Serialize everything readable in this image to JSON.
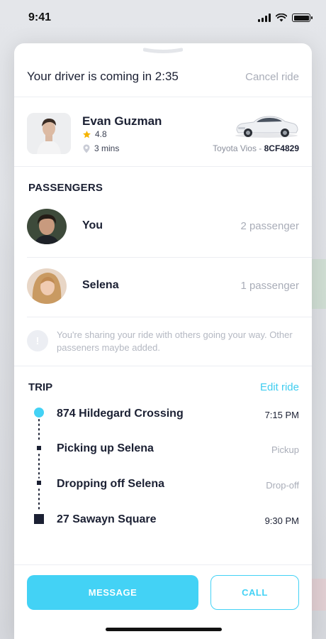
{
  "status_bar": {
    "time": "9:41"
  },
  "header": {
    "eta_text": "Your driver is coming in 2:35",
    "cancel_label": "Cancel ride"
  },
  "driver": {
    "name": "Evan Guzman",
    "rating": "4.8",
    "distance": "3 mins",
    "car_model": "Toyota Vios - ",
    "plate": "8CF4829"
  },
  "passengers": {
    "title": "PASSENGERS",
    "items": [
      {
        "name": "You",
        "count": "2 passenger"
      },
      {
        "name": "Selena",
        "count": "1 passenger"
      }
    ],
    "notice": "You're sharing your ride with others going your way. Other passeners maybe added."
  },
  "trip": {
    "title": "TRIP",
    "edit_label": "Edit ride",
    "stops": [
      {
        "name": "874 Hildegard Crossing",
        "meta": "7:15 PM"
      },
      {
        "name": "Picking up Selena",
        "meta": "Pickup"
      },
      {
        "name": "Dropping off Selena",
        "meta": "Drop-off"
      },
      {
        "name": "27 Sawayn Square",
        "meta": "9:30 PM"
      }
    ]
  },
  "actions": {
    "message_label": "MESSAGE",
    "call_label": "CALL"
  },
  "colors": {
    "accent": "#43d2f5",
    "text_dark": "#1b2033",
    "muted": "#a9adb8",
    "star": "#f5b400"
  }
}
